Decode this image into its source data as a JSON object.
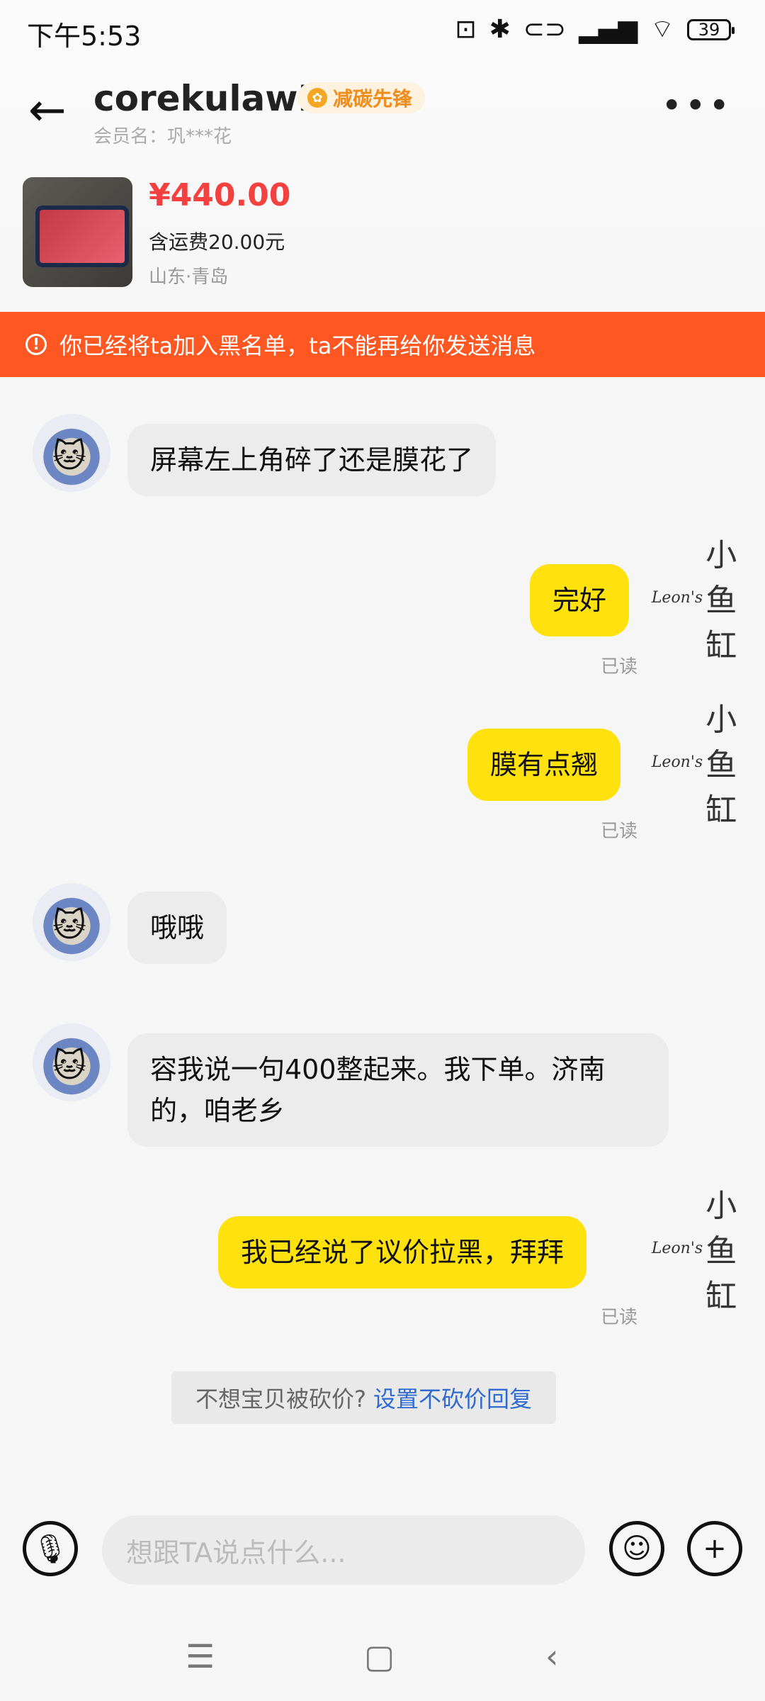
{
  "status": {
    "time": "下午5:53",
    "battery": "39"
  },
  "header": {
    "back_icon": "←",
    "nickname": "corekulawN",
    "badge": "减碳先锋",
    "member": "会员名：巩***花",
    "more_icon": "•••"
  },
  "product": {
    "price": "¥440.00",
    "shipping": "含运费20.00元",
    "location": "山东·青岛"
  },
  "banner": {
    "text": "你已经将ta加入黑名单，ta不能再给你发送消息"
  },
  "messages": [
    {
      "from": "them",
      "text": "屏幕左上角碎了还是膜花了"
    },
    {
      "from": "me",
      "text": "完好",
      "status": "已读"
    },
    {
      "from": "me",
      "text": "膜有点翘",
      "status": "已读"
    },
    {
      "from": "them",
      "text": "哦哦"
    },
    {
      "from": "them",
      "text": "容我说一句400整起来。我下单。济南的，咱老乡"
    },
    {
      "from": "me",
      "text": "我已经说了议价拉黑，拜拜",
      "status": "已读"
    }
  ],
  "my_avatar": {
    "script": "Leon's",
    "chars": "小鱼缸"
  },
  "hint": {
    "text": "不想宝贝被砍价?",
    "link": "设置不砍价回复"
  },
  "input": {
    "placeholder": "想跟TA说点什么..."
  },
  "colors": {
    "accent": "#ff5722",
    "price": "#f2413f",
    "bubble_out": "#ffe20d",
    "link": "#2e6ad1"
  }
}
